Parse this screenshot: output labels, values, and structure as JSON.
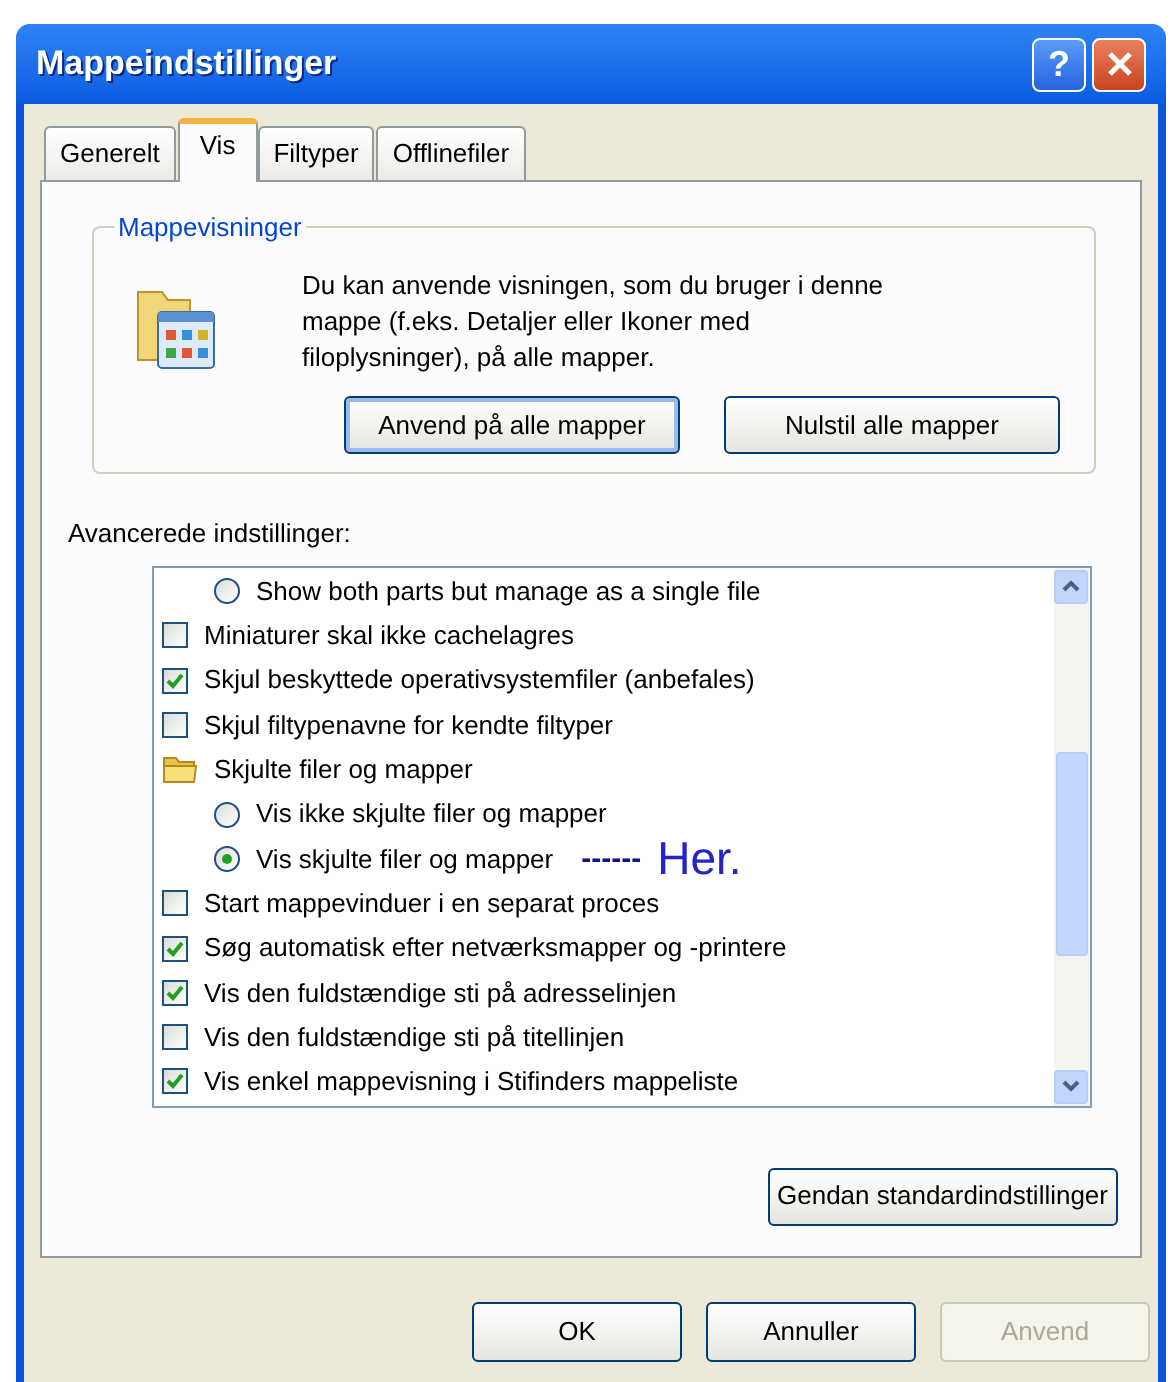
{
  "window": {
    "title": "Mappeindstillinger",
    "help_button": "?"
  },
  "tabs": [
    {
      "label": "Generelt",
      "selected": false
    },
    {
      "label": "Vis",
      "selected": true
    },
    {
      "label": "Filtyper",
      "selected": false
    },
    {
      "label": "Offlinefiler",
      "selected": false
    }
  ],
  "folder_views": {
    "title": "Mappevisninger",
    "description": "Du kan anvende visningen, som du bruger i denne mappe (f.eks. Detaljer eller Ikoner med filoplysninger), på alle mapper.",
    "buttons": [
      {
        "label": "Anvend på alle mapper",
        "focused": true
      },
      {
        "label": "Nulstil alle mapper",
        "focused": false
      }
    ]
  },
  "advanced": {
    "label": "Avancerede indstillinger:",
    "items": [
      {
        "kind": "radio",
        "label": "Show both parts but manage as a single file",
        "checked": false
      },
      {
        "kind": "checkbox",
        "label": "Miniaturer skal ikke cachelagres",
        "checked": false
      },
      {
        "kind": "checkbox",
        "label": "Skjul beskyttede operativsystemfiler (anbefales)",
        "checked": true
      },
      {
        "kind": "checkbox",
        "label": "Skjul filtypenavne for kendte filtyper",
        "checked": false
      },
      {
        "kind": "folder",
        "label": "Skjulte filer og mapper",
        "children": [
          {
            "kind": "radio",
            "label": "Vis ikke skjulte filer og mapper",
            "checked": false
          },
          {
            "kind": "radio",
            "label": "Vis skjulte filer og mapper",
            "checked": true,
            "annotation": {
              "dashes": "------",
              "text": "Her."
            }
          }
        ]
      },
      {
        "kind": "checkbox",
        "label": "Start mappevinduer i en separat proces",
        "checked": false
      },
      {
        "kind": "checkbox",
        "label": "Søg automatisk efter netværksmapper og -printere",
        "checked": true
      },
      {
        "kind": "checkbox",
        "label": "Vis den fuldstændige sti på adresselinjen",
        "checked": true
      },
      {
        "kind": "checkbox",
        "label": "Vis den fuldstændige sti på titellinjen",
        "checked": false
      },
      {
        "kind": "checkbox",
        "label": "Vis enkel mappevisning i Stifinders mappeliste",
        "checked": true
      }
    ],
    "restore_button": "Gendan standardindstillinger"
  },
  "footer_buttons": [
    {
      "label": "OK",
      "disabled": false
    },
    {
      "label": "Annuller",
      "disabled": false
    },
    {
      "label": "Anvend",
      "disabled": true
    }
  ]
}
